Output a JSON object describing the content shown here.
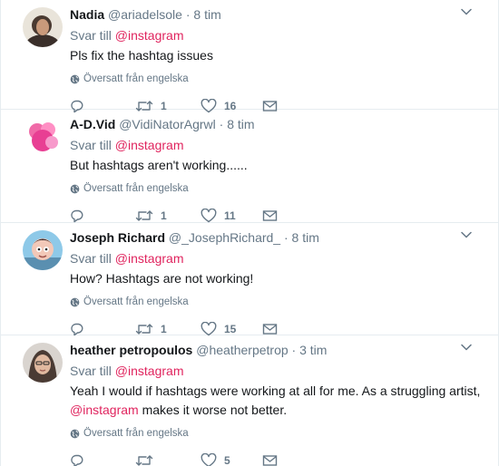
{
  "reply_prefix": "Svar till",
  "translate_label": "Översatt från engelska",
  "tweets": [
    {
      "name": "Nadia",
      "handle": "@ariadelsole",
      "sep": "·",
      "time": "8 tim",
      "reply_mention": "@instagram",
      "text": "Pls fix the hashtag issues",
      "retweets": "1",
      "likes": "16"
    },
    {
      "name": "A-D.Vid",
      "handle": "@VidiNatorAgrwl",
      "sep": "·",
      "time": "8 tim",
      "reply_mention": "@instagram",
      "text": "But hashtags aren't working......",
      "retweets": "1",
      "likes": "11"
    },
    {
      "name": "Joseph Richard",
      "handle": "@_JosephRichard_",
      "sep": "·",
      "time": "8 tim",
      "reply_mention": "@instagram",
      "text": "How? Hashtags are not working!",
      "retweets": "1",
      "likes": "15"
    },
    {
      "name": "heather petropoulos",
      "handle": "@heatherpetrop",
      "sep": "·",
      "time": "3 tim",
      "reply_mention": "@instagram",
      "text_before": "Yeah I would if hashtags were working at all for me. As a struggling artist,",
      "text_mention": "@instagram",
      "text_after": " makes it worse not better.",
      "retweets": "",
      "likes": "5"
    }
  ],
  "colors": {
    "mention": "#e0245e",
    "secondary": "#657786",
    "divider": "#e6ecf0"
  }
}
